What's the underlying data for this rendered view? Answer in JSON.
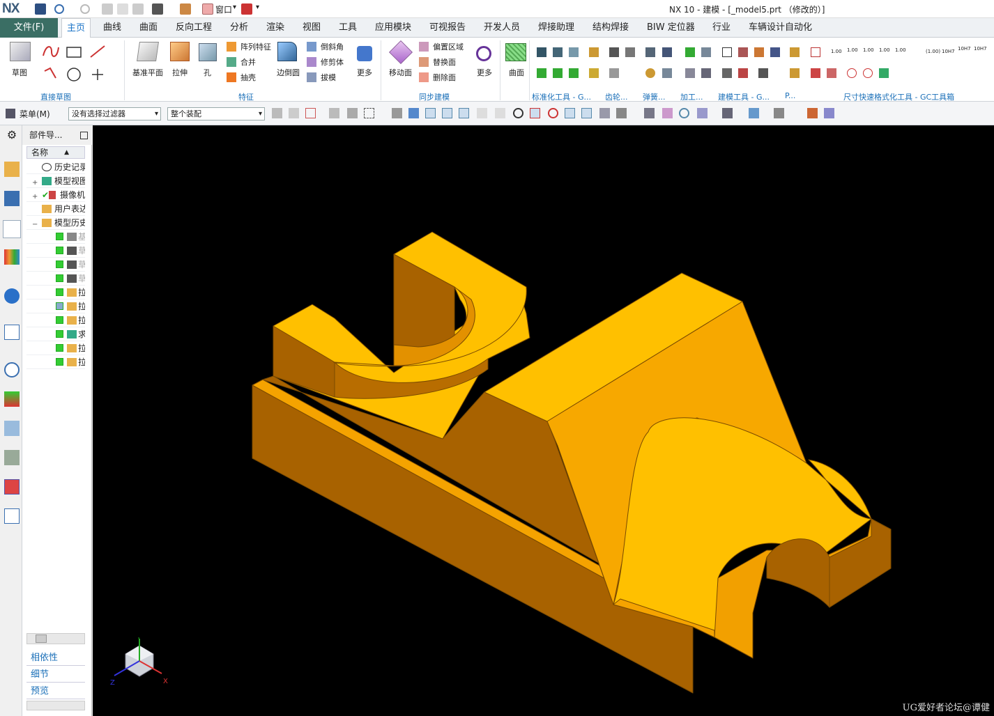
{
  "titlebar": {
    "logo": "NX",
    "window_menu": "窗口",
    "title": "NX 10 - 建模 - [_model5.prt （修改的）]"
  },
  "menubar": {
    "file": "文件(F)",
    "tabs": [
      "主页",
      "曲线",
      "曲面",
      "反向工程",
      "分析",
      "渲染",
      "视图",
      "工具",
      "应用模块",
      "可视报告",
      "开发人员",
      "焊接助理",
      "结构焊接",
      "BIW 定位器",
      "行业",
      "车辆设计自动化"
    ],
    "active_tab": "主页"
  },
  "ribbon": {
    "sketch": "草图",
    "datum_plane": "基准平面",
    "extrude": "拉伸",
    "hole": "孔",
    "pattern_feature": "阵列特征",
    "combine": "合并",
    "shell": "抽壳",
    "edge_blend": "边倒圆",
    "chamfer": "倒斜角",
    "trim_body": "修剪体",
    "draft": "拔模",
    "more1": "更多",
    "move_face": "移动面",
    "offset_region": "偏置区域",
    "replace_face": "替换面",
    "delete_face": "删除面",
    "more2": "更多",
    "surface": "曲面",
    "groups": {
      "direct_sketch": "直接草图",
      "feature": "特征",
      "sync_modeling": "同步建模",
      "standard_tools": "标准化工具 - G...",
      "gear": "齿轮...",
      "spring": "弹簧...",
      "machining": "加工...",
      "modeling_tools": "建模工具 - G...",
      "p": "P...",
      "dim_format": "尺寸快速格式化工具 - GC工具箱"
    },
    "dim_labels": [
      "1.00",
      "1.00",
      "1.00",
      "1.00",
      "1.00",
      "(1.00)",
      "10H7",
      "10H7",
      "10H7"
    ]
  },
  "selection_bar": {
    "menu": "菜单(M)",
    "filter": "没有选择过滤器",
    "scope": "整个装配"
  },
  "navigator": {
    "title": "部件导...",
    "column": "名称",
    "nodes": [
      {
        "label": "历史记录"
      },
      {
        "label": "模型视图"
      },
      {
        "label": "摄像机"
      },
      {
        "label": "用户表达式"
      },
      {
        "label": "模型历史"
      }
    ],
    "features": [
      "基",
      "草",
      "草",
      "草",
      "拉",
      "拉",
      "拉",
      "求",
      "拉",
      "拉"
    ],
    "sections": [
      "相依性",
      "细节",
      "预览"
    ]
  },
  "viewport": {
    "triad": {
      "x": "X",
      "y": "Y",
      "z": "Z"
    },
    "watermark": "UG爱好者论坛@谭健"
  },
  "colors": {
    "accent": "#1a73c7",
    "file_tab": "#3a6e64",
    "part_main": "#ffc000",
    "viewport_bg": "#000000"
  }
}
